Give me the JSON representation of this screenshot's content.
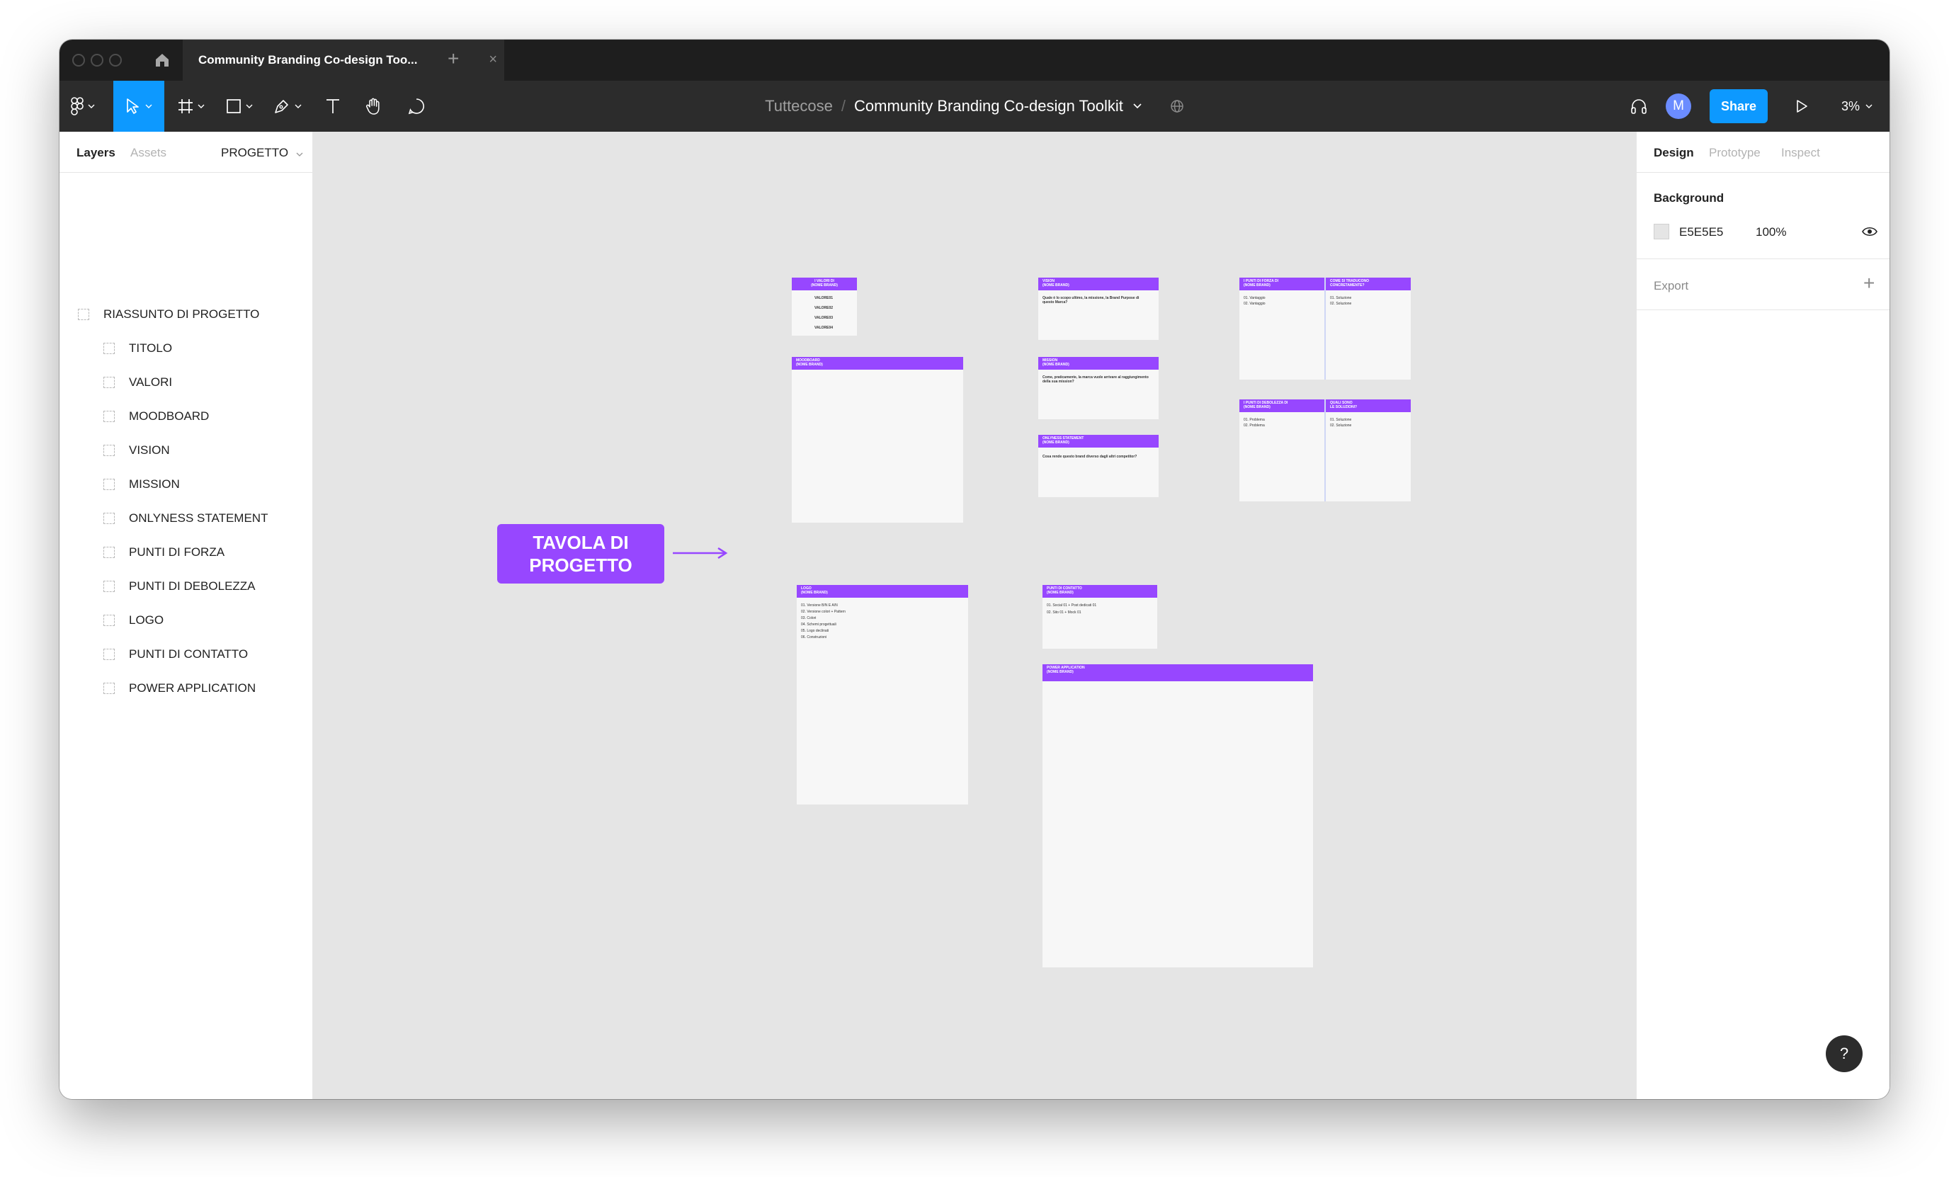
{
  "window": {
    "tab_title": "Community Branding Co-design Too...",
    "tab_close": "×",
    "new_tab": "+"
  },
  "toolbar": {
    "team": "Tuttecose",
    "separator": "/",
    "file_name": "Community Branding Co-design Toolkit",
    "avatar_initial": "M",
    "share_label": "Share",
    "zoom": "3%",
    "accent": "#0d99ff"
  },
  "left_panel": {
    "tabs": [
      "Layers",
      "Assets"
    ],
    "page_selector": "PROGETTO",
    "layers": [
      "RIASSUNTO DI PROGETTO",
      "TITOLO",
      "VALORI",
      "MOODBOARD",
      "VISION",
      "MISSION",
      "ONLYNESS STATEMENT",
      "PUNTI DI FORZA",
      "PUNTI DI DEBOLEZZA",
      "LOGO",
      "PUNTI DI CONTATTO",
      "POWER APPLICATION"
    ]
  },
  "canvas": {
    "background": "#e5e5e5",
    "frame_accent": "#9747ff",
    "label_line1": "TAVOLA DI",
    "label_line2": "PROGETTO",
    "frames": {
      "valori": {
        "title": "I VALORI DI\n(NOME BRAND)",
        "lines": [
          "VALORE01",
          "VALORE02",
          "VALORE03",
          "VALORE04"
        ]
      },
      "moodboard": {
        "title": "MOODBOARD\n(NOME BRAND)"
      },
      "vision": {
        "title": "VISION\n(NOME BRAND)",
        "text": "Quale è lo scopo ultimo, la missione, la Brand Purpose di questo Marca?"
      },
      "mission": {
        "title": "MISSION\n(NOME BRAND)",
        "text": "Come, praticamente, la marca vuole arrivare al raggiungimento della sua mission?"
      },
      "onlyness": {
        "title": "ONLYNESS STATEMENT\n(NOME BRAND)",
        "text": "Cosa rende questo brand diverso dagli altri competitor?"
      },
      "forza": {
        "title_left": "I PUNTI DI FORZA DI\n(NOME BRAND)",
        "title_right": "COME SI TRADUCONO\nCONCRETAMENTE?",
        "left_lines": [
          "01. Vantaggio",
          "02. Vantaggio"
        ],
        "right_lines": [
          "01. Soluzione",
          "02. Soluzione"
        ]
      },
      "debolezza": {
        "title_left": "I PUNTI DI DEBOLEZZA DI\n(NOME BRAND)",
        "title_right": "QUALI SONO\nLE SOLUZIONI?",
        "left_lines": [
          "01. Problema",
          "02. Problema"
        ],
        "right_lines": [
          "01. Soluzione",
          "02. Soluzione"
        ]
      },
      "logo": {
        "title": "LOGO\n(NOME BRAND)",
        "lines": [
          "01. Versione B/N E A/N",
          "02. Versione colori + Pattern",
          "03. Colori",
          "04. Schemi progettuali",
          "05. Logo declinati",
          "06. Construzioni"
        ]
      },
      "contatto": {
        "title": "PUNTI DI CONTATTO\n(NOME BRAND)",
        "lines": [
          "01. Social 01 + Post dedicati 01",
          "02. Sito 01 + Mock 01"
        ]
      },
      "power": {
        "title": "POWER APPLICATION\n(NOME BRAND)"
      }
    }
  },
  "right_panel": {
    "tabs": [
      "Design",
      "Prototype",
      "Inspect"
    ],
    "background_label": "Background",
    "background_hex": "E5E5E5",
    "background_opacity": "100%",
    "export_label": "Export",
    "add_label": "+"
  },
  "help_label": "?"
}
